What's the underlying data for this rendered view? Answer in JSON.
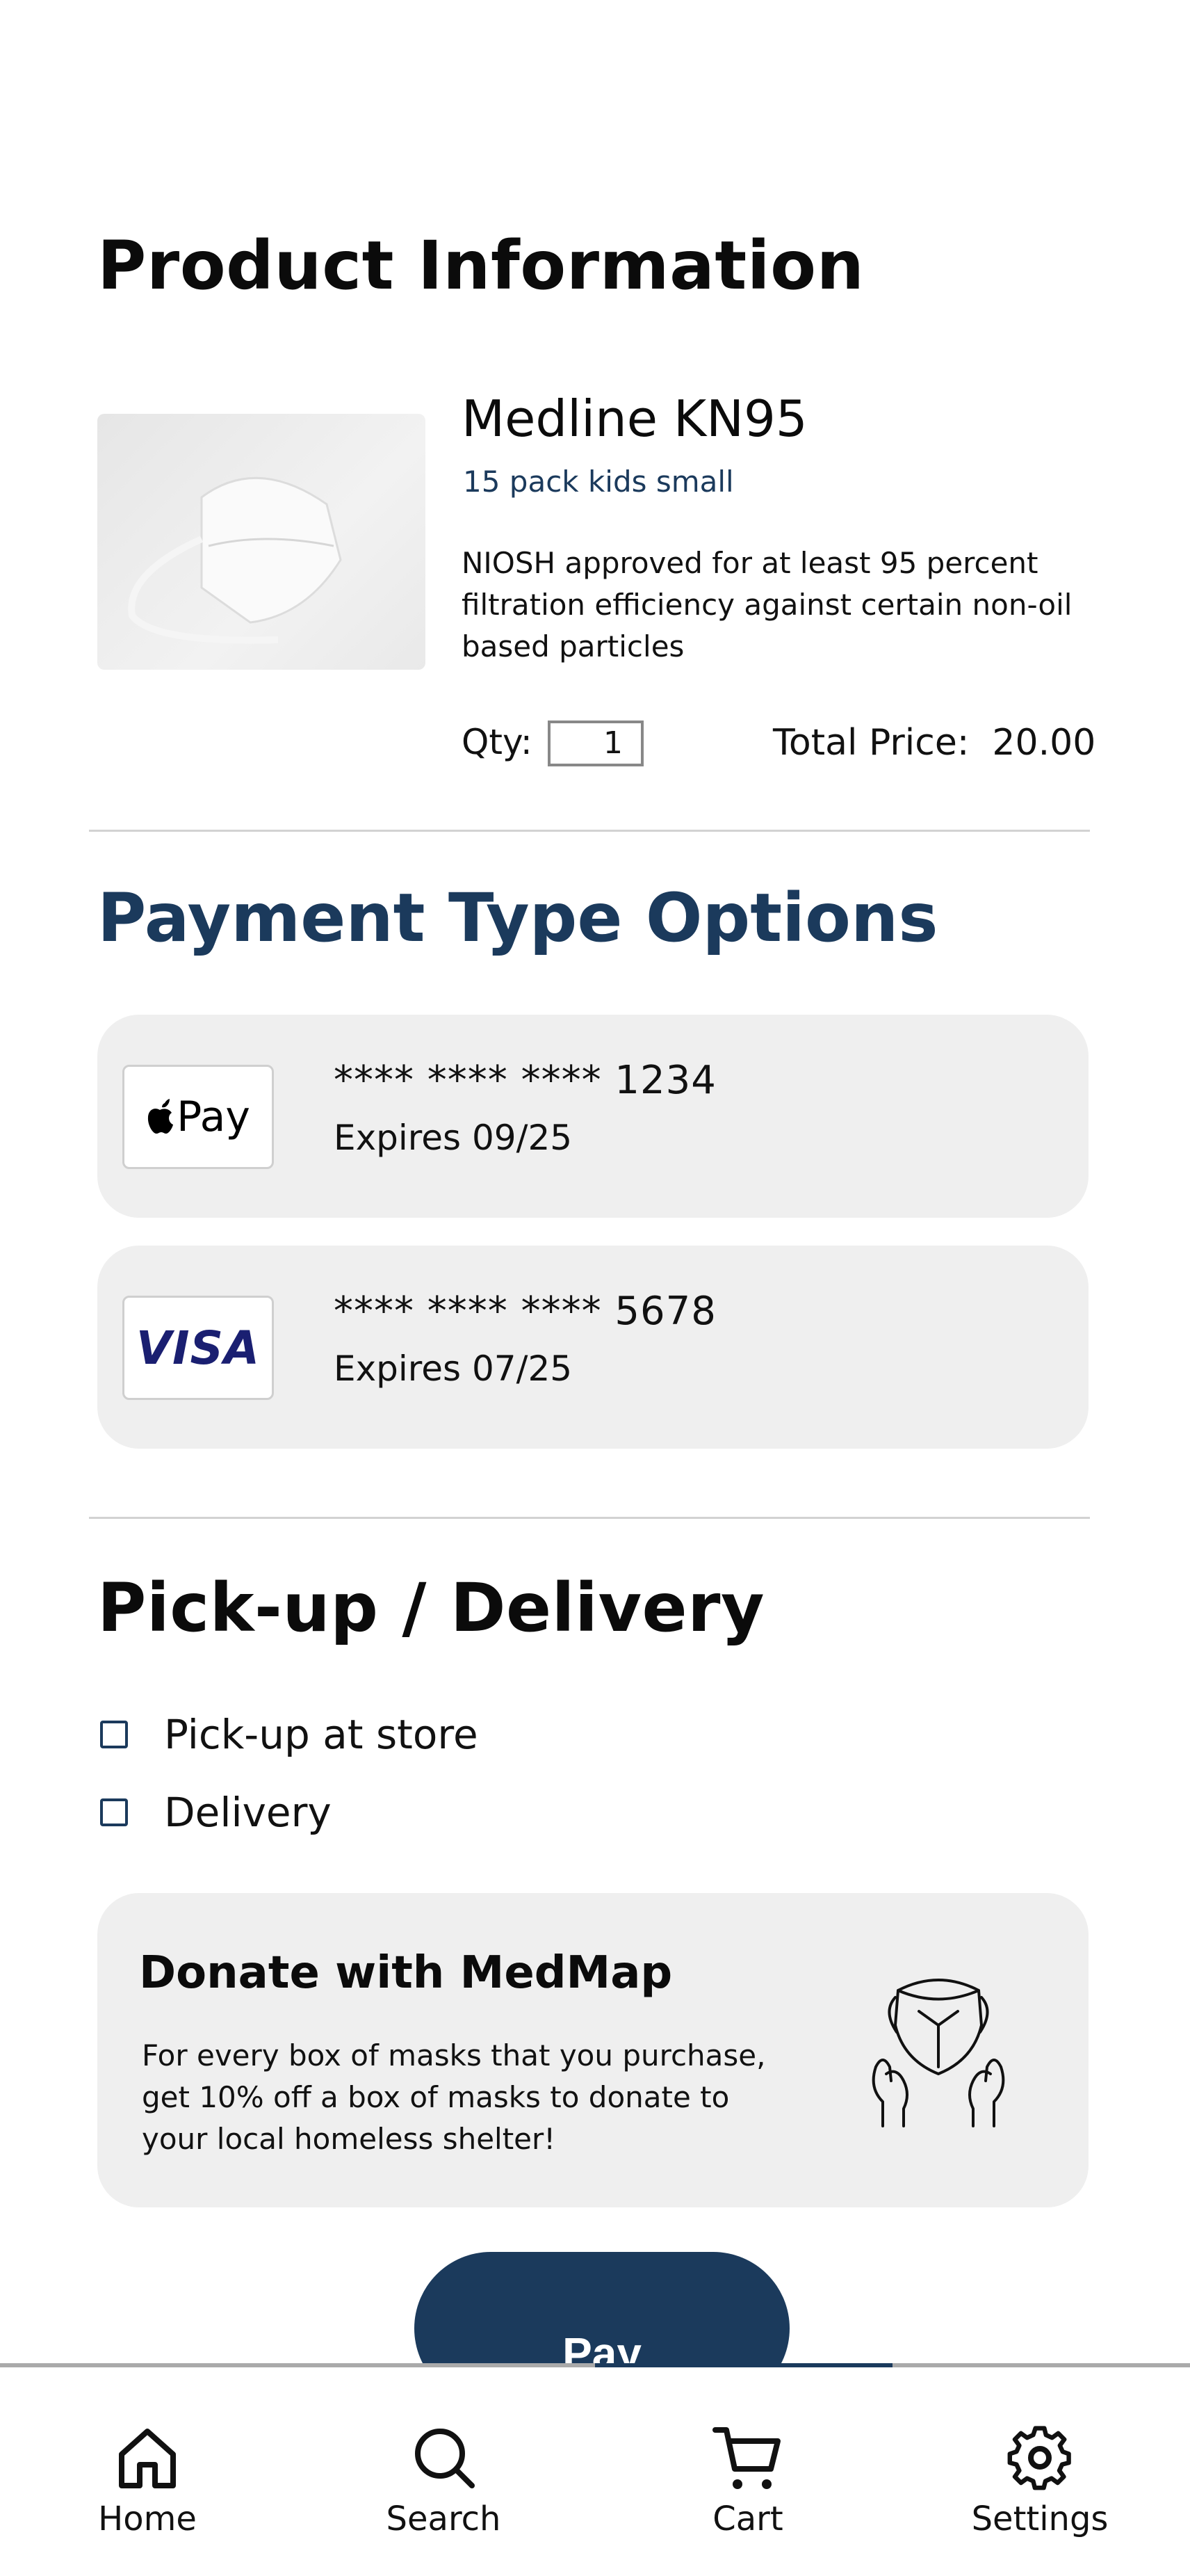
{
  "product_section": {
    "title": "Product Information",
    "name": "Medline KN95",
    "variant": "15 pack kids small",
    "description": "NIOSH approved for at least 95 percent filtration efficiency against certain non-oil based particles",
    "qty_label": "Qty:",
    "qty_value": "1",
    "total_label": "Total Price:",
    "total_value": "20.00"
  },
  "payment_section": {
    "title": "Payment Type Options",
    "cards": [
      {
        "logo": "apple-pay-logo",
        "logo_text": "Pay",
        "number": "**** **** **** 1234",
        "expires": "Expires 09/25"
      },
      {
        "logo": "visa-logo",
        "logo_text": "VISA",
        "number": "**** **** **** 5678",
        "expires": "Expires 07/25"
      }
    ]
  },
  "delivery_section": {
    "title": "Pick-up / Delivery",
    "options": [
      "Pick-up at store",
      "Delivery"
    ]
  },
  "donate": {
    "title": "Donate with MedMap",
    "text": "For every box of masks that you purchase, get 10% off a box of masks to donate to your local homeless shelter!"
  },
  "pay_button": "Pay",
  "bottom_nav": {
    "items": [
      {
        "label": "Home",
        "icon": "home-icon"
      },
      {
        "label": "Search",
        "icon": "search-icon"
      },
      {
        "label": "Cart",
        "icon": "cart-icon"
      },
      {
        "label": "Settings",
        "icon": "gear-icon"
      }
    ],
    "active_index": 2
  },
  "colors": {
    "accent": "#1b3a5c",
    "card_bg": "#efefef",
    "divider": "#d2d2d2"
  }
}
